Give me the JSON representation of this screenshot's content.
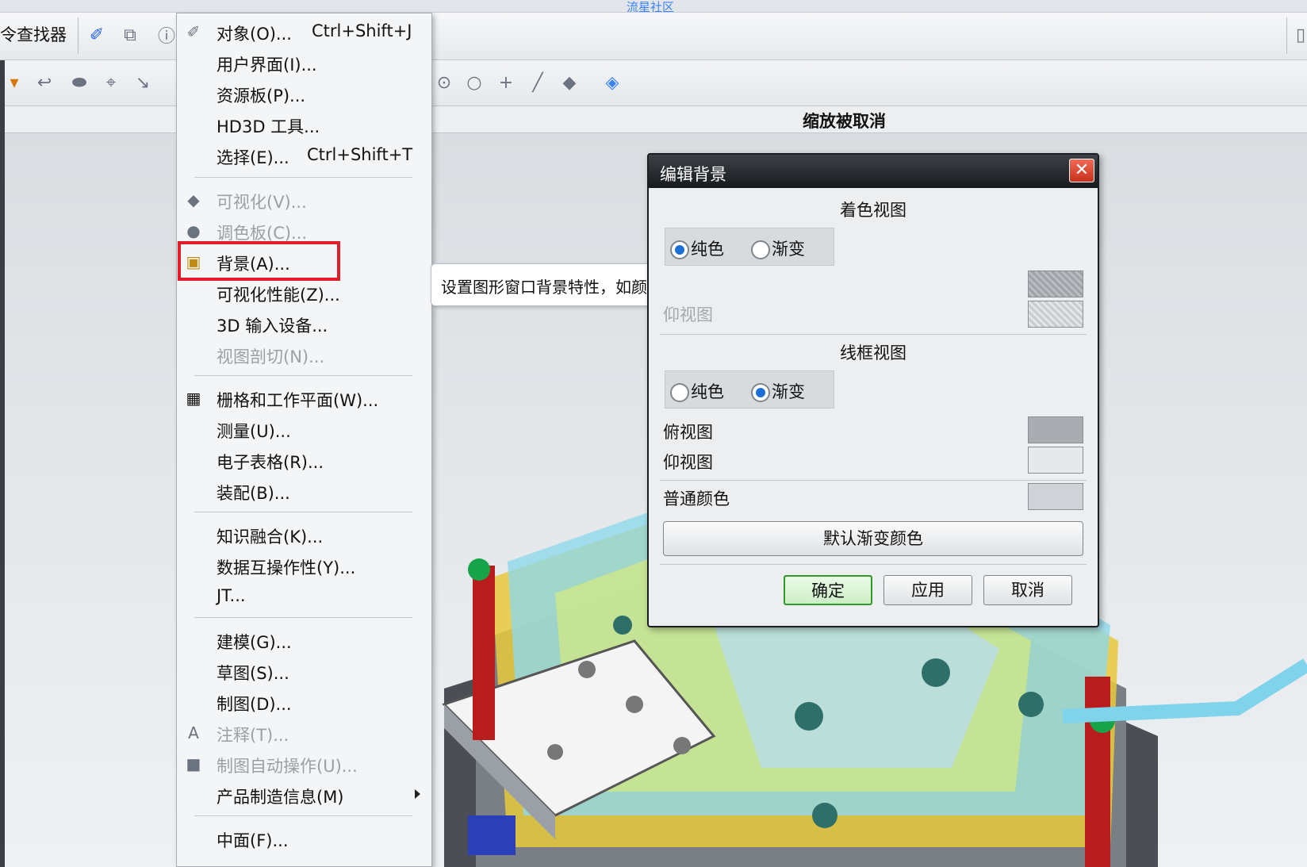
{
  "watermark": "流星社区",
  "toolbar": {
    "finder_label": "令查找器",
    "zoom_status": "缩放被取消"
  },
  "menu": {
    "items": [
      {
        "label": "对象(O)...",
        "shortcut": "Ctrl+Shift+J",
        "icon": "object-icon",
        "disabled": false
      },
      {
        "label": "用户界面(I)...",
        "shortcut": "",
        "icon": "",
        "disabled": false
      },
      {
        "label": "资源板(P)...",
        "shortcut": "",
        "icon": "",
        "disabled": false
      },
      {
        "label": "HD3D 工具...",
        "shortcut": "",
        "icon": "",
        "disabled": false
      },
      {
        "label": "选择(E)...",
        "shortcut": "Ctrl+Shift+T",
        "icon": "",
        "disabled": false
      },
      {
        "label": "可视化(V)...",
        "shortcut": "",
        "icon": "visualize-icon",
        "disabled": true
      },
      {
        "label": "调色板(C)...",
        "shortcut": "",
        "icon": "palette-icon",
        "disabled": true
      },
      {
        "label": "背景(A)...",
        "shortcut": "",
        "icon": "background-icon",
        "disabled": false
      },
      {
        "label": "可视化性能(Z)...",
        "shortcut": "",
        "icon": "",
        "disabled": false
      },
      {
        "label": "3D 输入设备...",
        "shortcut": "",
        "icon": "",
        "disabled": false
      },
      {
        "label": "视图剖切(N)...",
        "shortcut": "",
        "icon": "",
        "disabled": true
      },
      {
        "label": "栅格和工作平面(W)...",
        "shortcut": "",
        "icon": "grid-icon",
        "disabled": false
      },
      {
        "label": "测量(U)...",
        "shortcut": "",
        "icon": "",
        "disabled": false
      },
      {
        "label": "电子表格(R)...",
        "shortcut": "",
        "icon": "",
        "disabled": false
      },
      {
        "label": "装配(B)...",
        "shortcut": "",
        "icon": "",
        "disabled": false
      },
      {
        "label": "知识融合(K)...",
        "shortcut": "",
        "icon": "",
        "disabled": false
      },
      {
        "label": "数据互操作性(Y)...",
        "shortcut": "",
        "icon": "",
        "disabled": false
      },
      {
        "label": "JT...",
        "shortcut": "",
        "icon": "",
        "disabled": false
      },
      {
        "label": "建模(G)...",
        "shortcut": "",
        "icon": "",
        "disabled": false
      },
      {
        "label": "草图(S)...",
        "shortcut": "",
        "icon": "",
        "disabled": false
      },
      {
        "label": "制图(D)...",
        "shortcut": "",
        "icon": "",
        "disabled": false
      },
      {
        "label": "注释(T)...",
        "shortcut": "",
        "icon": "annotation-icon",
        "disabled": true
      },
      {
        "label": "制图自动操作(U)...",
        "shortcut": "",
        "icon": "drafting-automation-icon",
        "disabled": true
      },
      {
        "label": "产品制造信息(M)",
        "shortcut": "",
        "icon": "",
        "disabled": false,
        "submenu": true
      },
      {
        "label": "中面(F)...",
        "shortcut": "",
        "icon": "",
        "disabled": false
      }
    ]
  },
  "tooltip": "设置图形窗口背景特性，如颜色和渐变效果。",
  "dialog": {
    "title": "编辑背景",
    "shaded": {
      "heading": "着色视图",
      "solid_label": "纯色",
      "gradient_label": "渐变",
      "selected": "solid",
      "bottom_label": "仰视图"
    },
    "wireframe": {
      "heading": "线框视图",
      "solid_label": "纯色",
      "gradient_label": "渐变",
      "selected": "gradient",
      "top_label": "俯视图",
      "bottom_label": "仰视图"
    },
    "plain_color_label": "普通颜色",
    "default_button": "默认渐变颜色",
    "ok_button": "确定",
    "apply_button": "应用",
    "cancel_button": "取消"
  },
  "colors": {
    "highlight_box": "#e11d2a",
    "ok_border": "#2f9a2a",
    "title_bar": "#17191c"
  }
}
